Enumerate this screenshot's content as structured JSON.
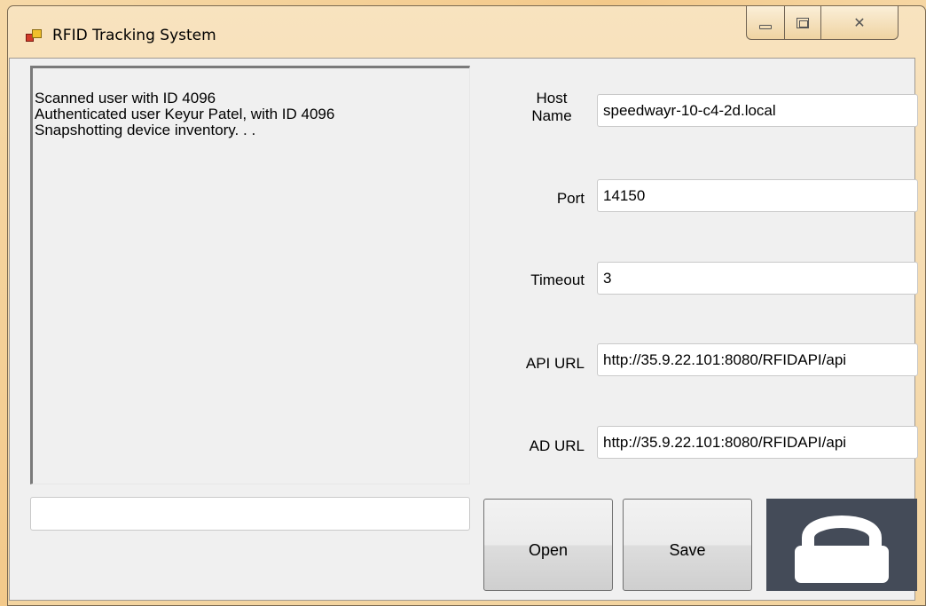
{
  "window": {
    "title": "RFID Tracking System",
    "controls": {
      "minimize": "minimize-icon",
      "maximize": "restore-icon",
      "close": "close-icon"
    }
  },
  "log": {
    "lines": [
      "Scanned user with ID 4096",
      "Authenticated user Keyur Patel, with ID 4096",
      "Snapshotting device inventory. . ."
    ]
  },
  "command_input": {
    "value": ""
  },
  "settings": {
    "host_name": {
      "label_line1": "Host",
      "label_line2": "Name",
      "value": "speedwayr-10-c4-2d.local"
    },
    "port": {
      "label": "Port",
      "value": "14150"
    },
    "timeout": {
      "label": "Timeout",
      "value": "3"
    },
    "api_url": {
      "label": "API URL",
      "value": "http://35.9.22.101:8080/RFIDAPI/api"
    },
    "ad_url": {
      "label": "AD URL",
      "value": "http://35.9.22.101:8080/RFIDAPI/api"
    }
  },
  "buttons": {
    "open": "Open",
    "save": "Save"
  },
  "lock": {
    "icon": "lock-icon",
    "state": "locked"
  },
  "colors": {
    "lock_panel_bg": "#444b58",
    "client_bg": "#f0f0f0"
  }
}
